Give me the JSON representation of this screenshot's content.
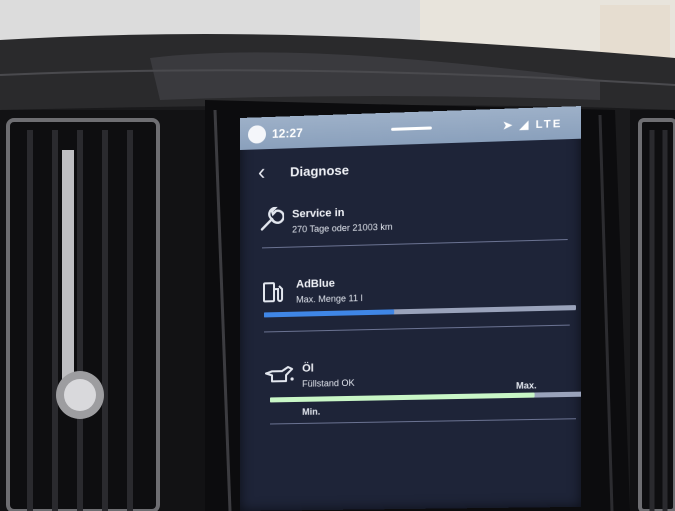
{
  "status_bar": {
    "time": "12:27",
    "network": "LTE"
  },
  "header": {
    "title": "Diagnose"
  },
  "service": {
    "title": "Service in",
    "detail": "270 Tage oder 21003 km"
  },
  "adblue": {
    "title": "AdBlue",
    "detail": "Max. Menge 11 l",
    "fill_fraction": 0.42
  },
  "oil": {
    "title": "Öl",
    "detail": "Füllstand OK",
    "min_label": "Min.",
    "max_label": "Max.",
    "level_fraction": 0.85
  },
  "colors": {
    "screen_bg": "#1e2438",
    "status_bar": "#8aa0bc",
    "adblue_fill": "#3f86e6",
    "oil_fill": "#c9f7c7"
  }
}
